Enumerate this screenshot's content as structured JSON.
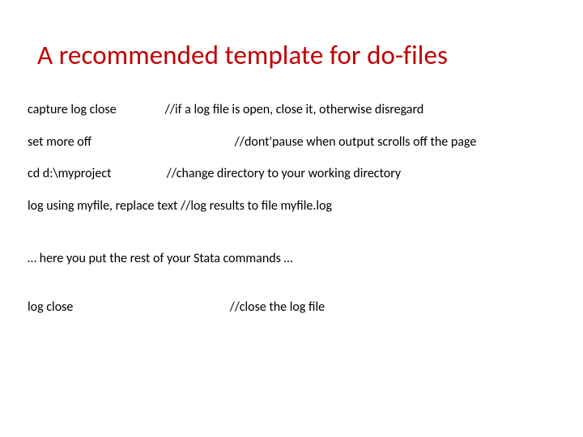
{
  "title": "A recommended template for do-files",
  "lines": {
    "l1": {
      "cmd": "capture log close",
      "comment": "//if a log file is open, close it, otherwise disregard"
    },
    "l2": {
      "cmd": "set more off",
      "comment": "//dont'pause when output scrolls off the page"
    },
    "l3": {
      "cmd": "cd d:\\myproject",
      "comment": "//change directory to your working directory"
    },
    "l4": {
      "cmd": "log using myfile, replace text",
      "comment": "//log results to file myfile.log"
    },
    "l5": {
      "cmd": "… here you put the rest of your Stata commands …"
    },
    "l6": {
      "cmd": "log close",
      "comment": "//close the log file"
    }
  }
}
